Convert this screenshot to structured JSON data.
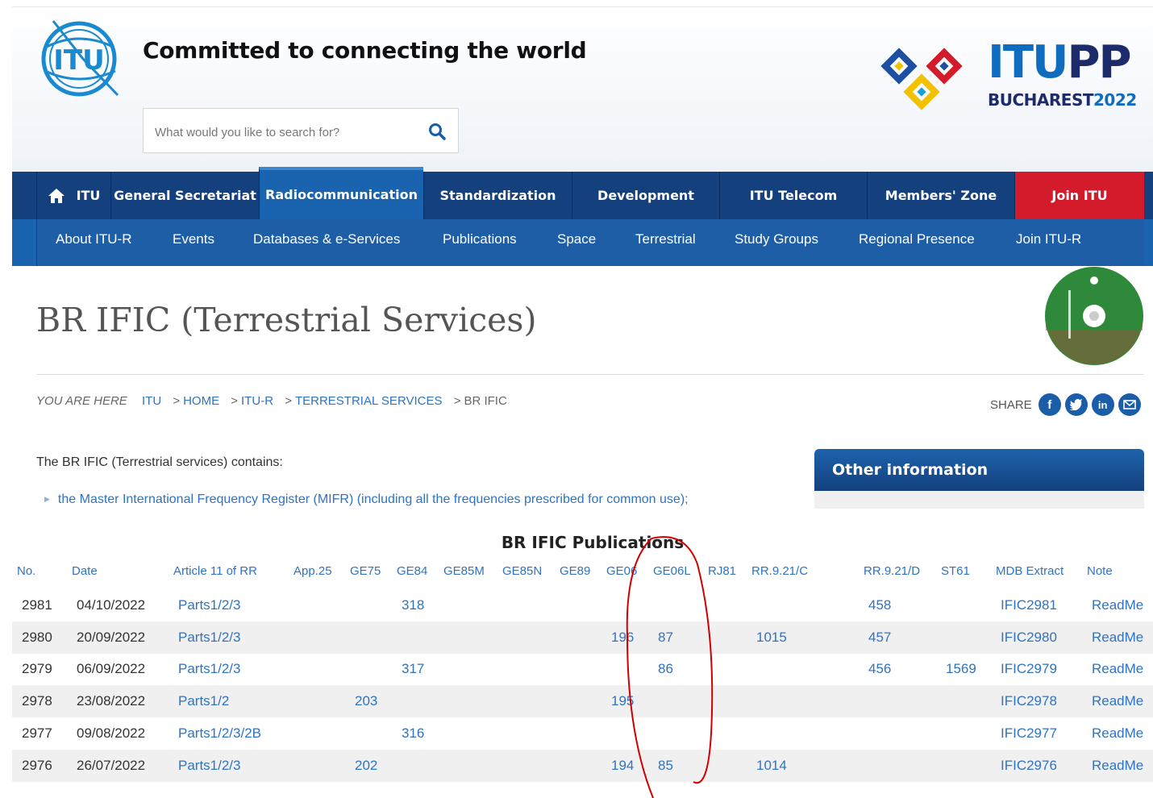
{
  "header": {
    "tagline": "Committed to connecting the world",
    "search_placeholder": "What would you like to search for?",
    "logo_text": "ITU",
    "event_logo": {
      "big1": "ITU",
      "big2": "PP",
      "small1": "BUCHAREST",
      "small2": "2022"
    }
  },
  "colors": {
    "navy": "#14407d",
    "blue": "#1a63ae",
    "join_red": "#d41b2c",
    "link": "#2f73c1"
  },
  "nav_primary": [
    {
      "label": "ITU",
      "icon": "home-icon"
    },
    {
      "label": "General Secretariat"
    },
    {
      "label": "Radiocommunication",
      "active": true
    },
    {
      "label": "Standardization"
    },
    {
      "label": "Development"
    },
    {
      "label": "ITU Telecom"
    },
    {
      "label": "Members' Zone"
    },
    {
      "label": "Join ITU"
    }
  ],
  "nav_secondary": [
    "About ITU-R",
    "Events",
    "Databases & e-Services",
    "Publications",
    "Space",
    "Terrestrial",
    "Study Groups",
    "Regional Presence",
    "Join ITU-R"
  ],
  "page": {
    "title": "BR IFIC (Terrestrial Services)",
    "breadcrumb": {
      "label": "YOU ARE HERE",
      "items": [
        "ITU",
        "HOME",
        "ITU-R",
        "TERRESTRIAL SERVICES",
        "BR IFIC"
      ]
    },
    "share_label": "SHARE",
    "share_icons": [
      "facebook-icon",
      "twitter-icon",
      "linkedin-icon",
      "email-icon"
    ],
    "intro": "The BR IFIC (Terrestrial services) contains:",
    "bullet": "the Master International Frequency Register (MIFR) (including all the frequencies prescribed for common use);",
    "other_info_title": "Other information"
  },
  "publications": {
    "title": "BR IFIC Publications",
    "columns": [
      "No.",
      "Date",
      "Article 11 of RR",
      "App.25",
      "GE75",
      "GE84",
      "GE85M",
      "GE85N",
      "GE89",
      "GE06",
      "GE06L",
      "RJ81",
      "RR.9.21/C",
      "RR.9.21/D",
      "ST61",
      "MDB Extract",
      "Note"
    ],
    "rows": [
      {
        "no": "2981",
        "date": "04/10/2022",
        "art11": "Parts1/2/3",
        "ge75": "",
        "ge84": "318",
        "ge06": "",
        "ge06l": "",
        "rr921c": "",
        "rr921d": "458",
        "st61": "",
        "mdb": "IFIC2981",
        "note": "ReadMe"
      },
      {
        "no": "2980",
        "date": "20/09/2022",
        "art11": "Parts1/2/3",
        "ge75": "",
        "ge84": "",
        "ge06": "196",
        "ge06l": "87",
        "rr921c": "1015",
        "rr921d": "457",
        "st61": "",
        "mdb": "IFIC2980",
        "note": "ReadMe"
      },
      {
        "no": "2979",
        "date": "06/09/2022",
        "art11": "Parts1/2/3",
        "ge75": "",
        "ge84": "317",
        "ge06": "",
        "ge06l": "86",
        "rr921c": "",
        "rr921d": "456",
        "st61": "1569",
        "mdb": "IFIC2979",
        "note": "ReadMe"
      },
      {
        "no": "2978",
        "date": "23/08/2022",
        "art11": "Parts1/2",
        "ge75": "203",
        "ge84": "",
        "ge06": "195",
        "ge06l": "",
        "rr921c": "",
        "rr921d": "",
        "st61": "",
        "mdb": "IFIC2978",
        "note": "ReadMe"
      },
      {
        "no": "2977",
        "date": "09/08/2022",
        "art11": "Parts1/2/3/2B",
        "ge75": "",
        "ge84": "316",
        "ge06": "",
        "ge06l": "",
        "rr921c": "",
        "rr921d": "",
        "st61": "",
        "mdb": "IFIC2977",
        "note": "ReadMe"
      },
      {
        "no": "2976",
        "date": "26/07/2022",
        "art11": "Parts1/2/3",
        "ge75": "202",
        "ge84": "",
        "ge06": "194",
        "ge06l": "85",
        "rr921c": "1014",
        "rr921d": "",
        "st61": "",
        "mdb": "IFIC2976",
        "note": "ReadMe"
      }
    ]
  }
}
